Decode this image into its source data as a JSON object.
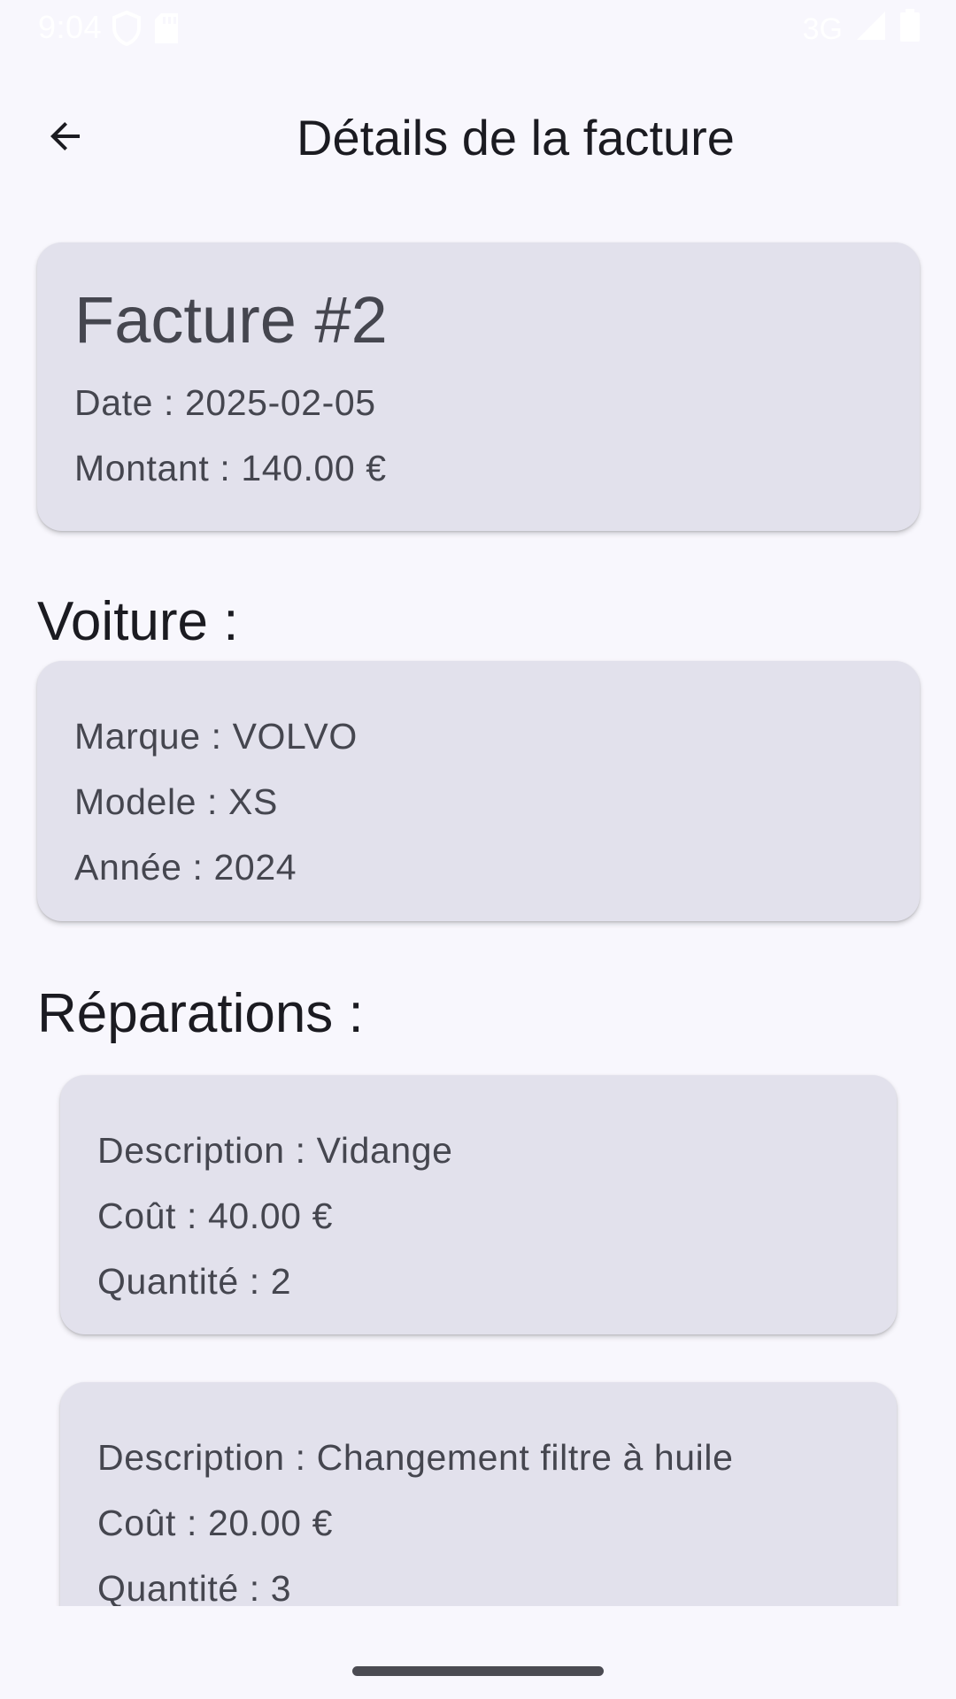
{
  "status_bar": {
    "time": "9:04",
    "network": "3G",
    "icons": [
      "shield-icon",
      "sd-card-icon",
      "signal-icon",
      "battery-icon"
    ]
  },
  "app_bar": {
    "title": "Détails de la facture",
    "back_icon": "arrow-back-icon"
  },
  "invoice": {
    "title": "Facture #2",
    "date": "Date : 2025-02-05",
    "amount": "Montant : 140.00 €"
  },
  "car": {
    "heading": "Voiture :",
    "brand": "Marque : VOLVO",
    "model": "Modele : XS",
    "year": "Année : 2024"
  },
  "repairs": {
    "heading": "Réparations :",
    "items": [
      {
        "description": "Description : Vidange",
        "cost": "Coût : 40.00 €",
        "quantity": "Quantité : 2"
      },
      {
        "description": "Description : Changement filtre à huile",
        "cost": "Coût : 20.00 €",
        "quantity": "Quantité : 3"
      }
    ]
  },
  "colors": {
    "background": "#f8f7fd",
    "card": "#e2e1ec",
    "card_text": "#45464f",
    "title_text": "#1b1b21"
  }
}
